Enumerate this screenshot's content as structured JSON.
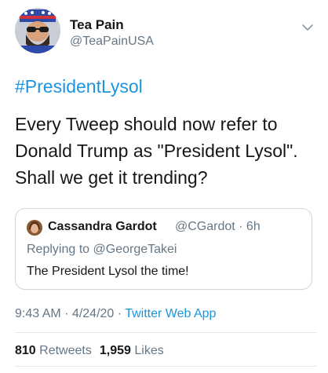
{
  "tweet": {
    "author": {
      "name": "Tea Pain",
      "handle": "@TeaPainUSA",
      "avatar_icon": "profile-avatar-icon"
    },
    "hashtag": "#PresidentLysol",
    "text": "Every Tweep should now refer to Donald Trump as \"President Lysol\". Shall we get it trending?",
    "quoted": {
      "name": "Cassandra Gardot",
      "handle_time": "@CGardot · 6h",
      "replying_prefix": "Replying to ",
      "replying_to": "@GeorgeTakei",
      "text": "The President Lysol the time!"
    },
    "meta": {
      "time_date": "9:43 AM · 4/24/20 · ",
      "source": "Twitter Web App"
    },
    "stats": {
      "retweets_count": "810",
      "retweets_label": "Retweets",
      "likes_count": "1,959",
      "likes_label": "Likes"
    }
  },
  "colors": {
    "link": "#1b95e0",
    "secondary_text": "#657786",
    "primary_text": "#14171a",
    "border": "#ccd6dd"
  }
}
